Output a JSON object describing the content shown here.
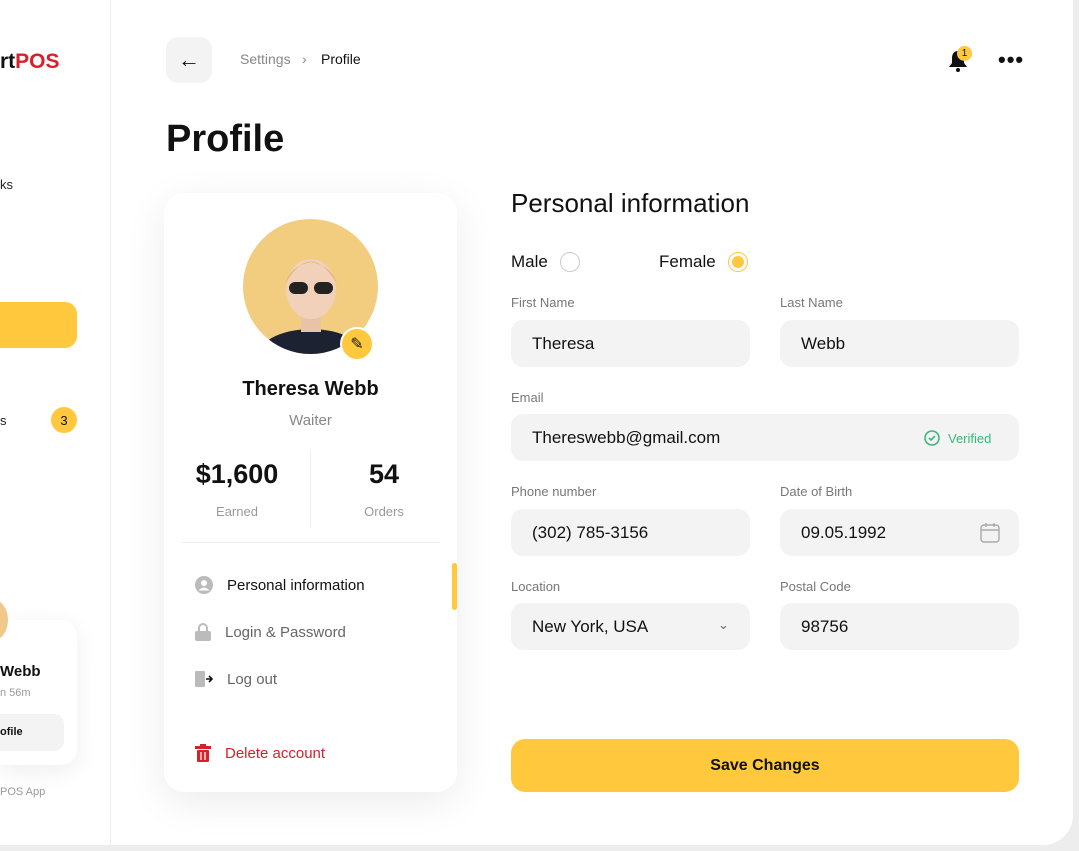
{
  "sidebar": {
    "logo_left": "rt",
    "logo_right": "POS",
    "item_fragment": "ks",
    "item_fragment2": "s",
    "badge": "3",
    "user_name": "Webb",
    "user_time": "n 56m",
    "profile_button": "ofile",
    "footer": "POS App"
  },
  "header": {
    "breadcrumb": [
      "Settings",
      "Profile"
    ],
    "notification_count": "1"
  },
  "page_title": "Profile",
  "profile": {
    "name": "Theresa Webb",
    "role": "Waiter",
    "earned_value": "$1,600",
    "earned_label": "Earned",
    "orders_value": "54",
    "orders_label": "Orders",
    "menu": [
      "Personal information",
      "Login & Password",
      "Log out"
    ],
    "delete": "Delete account"
  },
  "form": {
    "title": "Personal information",
    "gender": {
      "male": "Male",
      "female": "Female",
      "selected": "Female"
    },
    "first_name": {
      "label": "First Name",
      "value": "Theresa"
    },
    "last_name": {
      "label": "Last Name",
      "value": "Webb"
    },
    "email": {
      "label": "Email",
      "value": "Thereswebb@gmail.com",
      "status": "Verified"
    },
    "phone": {
      "label": "Phone number",
      "value": "(302) 785-3156"
    },
    "dob": {
      "label": "Date of Birth",
      "value": "09.05.1992"
    },
    "location": {
      "label": "Location",
      "value": "New York, USA"
    },
    "postal": {
      "label": "Postal Code",
      "value": "98756"
    },
    "save": "Save Changes"
  },
  "colors": {
    "accent": "#ffc83d",
    "danger": "#d8202a",
    "verified": "#3bb77e"
  }
}
